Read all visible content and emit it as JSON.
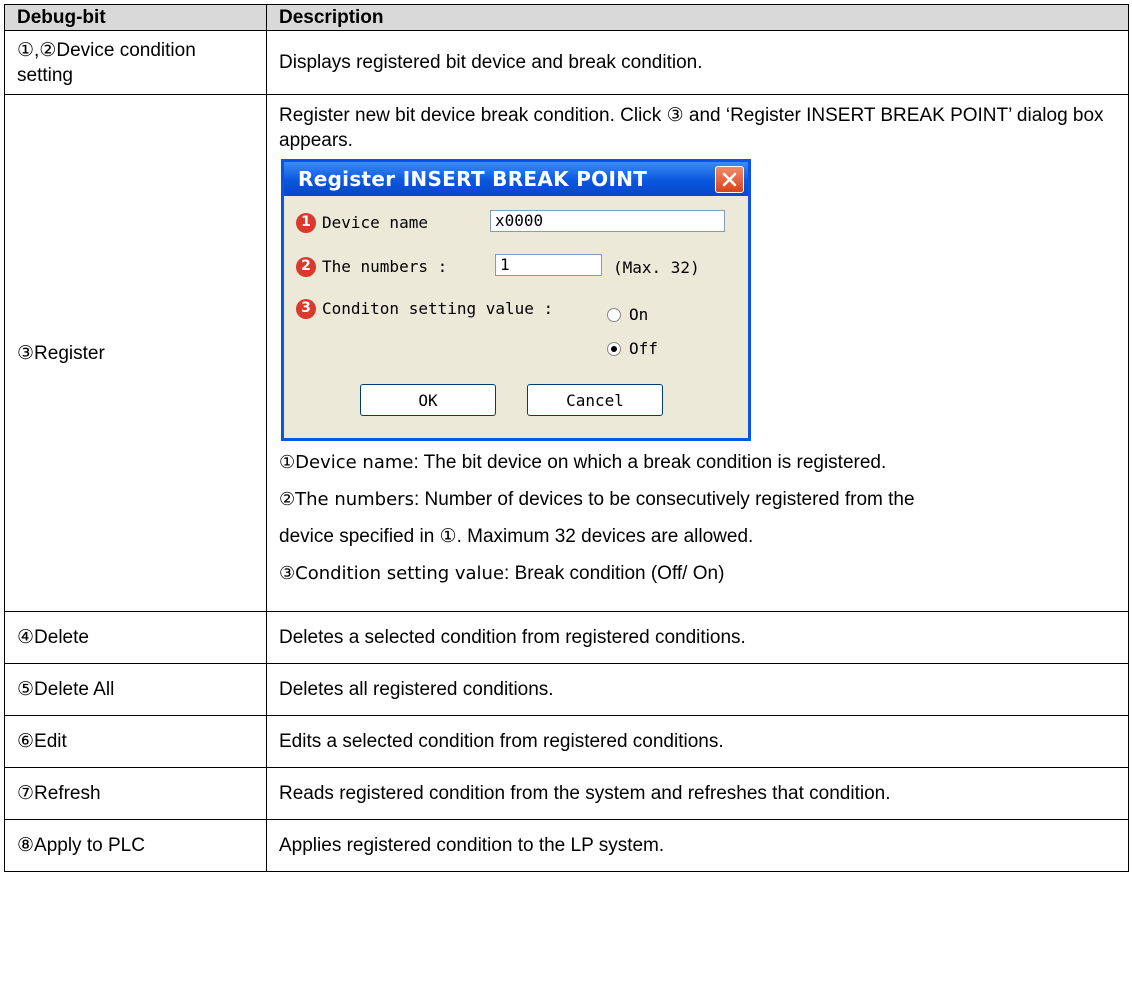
{
  "table": {
    "header": {
      "col1": "Debug-bit",
      "col2": "Description"
    },
    "rows": [
      {
        "name": "①,②Device condition setting",
        "desc": "Displays registered bit device and break condition."
      },
      {
        "name": "③Register",
        "desc": "Register new bit device break condition. Click ③ and ‘Register INSERT BREAK POINT’ dialog box appears."
      },
      {
        "name": "④Delete",
        "desc": "Deletes a selected condition from registered conditions."
      },
      {
        "name": "⑤Delete All",
        "desc": "Deletes all registered conditions."
      },
      {
        "name": "⑥Edit",
        "desc": "Edits a selected condition from registered conditions."
      },
      {
        "name": "⑦Refresh",
        "desc": "Reads registered condition from the system and refreshes that condition."
      },
      {
        "name": "⑧Apply to PLC",
        "desc": "Applies registered condition to the LP system."
      }
    ],
    "register_details": [
      {
        "key": "①Device name",
        "text": ": The bit device on which a break condition is registered."
      },
      {
        "key": "②The numbers",
        "text": ": Number of devices to be consecutively registered from the"
      },
      {
        "key": "",
        "text": "device specified in ①. Maximum 32 devices are allowed."
      },
      {
        "key": "③Condition setting value",
        "text": ": Break condition (Off/ On)"
      }
    ]
  },
  "dialog": {
    "title": "Register INSERT BREAK POINT",
    "close_icon": "close-x-icon",
    "device_name_num": "1",
    "device_name_label": "Device name",
    "device_name_value": "x0000",
    "numbers_num": "2",
    "numbers_label": "The numbers :",
    "numbers_value": "1",
    "numbers_hint": "(Max. 32)",
    "condition_num": "3",
    "condition_label": "Conditon setting value :",
    "option_on": "On",
    "option_off": "Off",
    "selected_option": "Off",
    "ok_label": "OK",
    "cancel_label": "Cancel"
  },
  "colors": {
    "title_bar": "#0a57df",
    "dialog_bg": "#ece9d8",
    "header_bg": "#d9d9d9",
    "marker_red": "#d93a2b"
  }
}
